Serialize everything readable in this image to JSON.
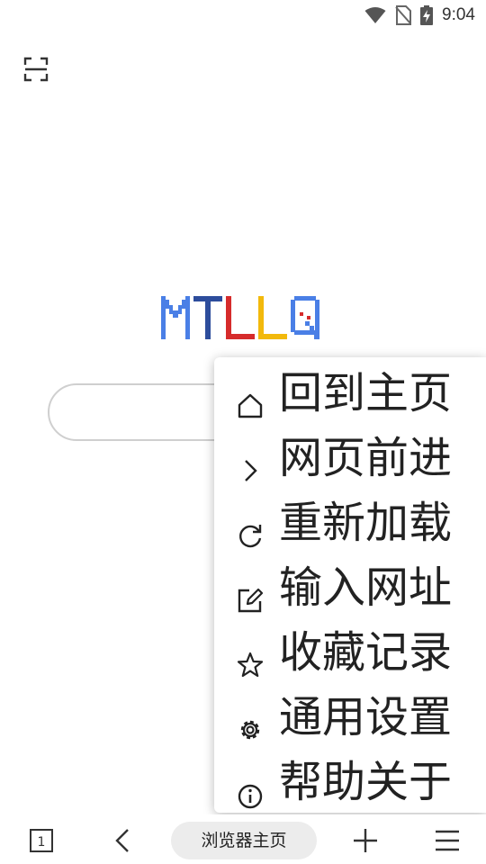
{
  "status_bar": {
    "time": "9:04"
  },
  "logo": {
    "text": "MTLLQ",
    "colors": [
      "#4a7fe6",
      "#2d4d9c",
      "#d62b2b",
      "#f2b90c",
      "#4a7fe6"
    ]
  },
  "search": {
    "placeholder": ""
  },
  "menu": {
    "items": [
      {
        "label": "回到主页",
        "icon": "home-icon"
      },
      {
        "label": "网页前进",
        "icon": "chevron-right-icon"
      },
      {
        "label": "重新加载",
        "icon": "reload-icon"
      },
      {
        "label": "输入网址",
        "icon": "edit-icon"
      },
      {
        "label": "收藏记录",
        "icon": "star-icon"
      },
      {
        "label": "通用设置",
        "icon": "gear-icon"
      },
      {
        "label": "帮助关于",
        "icon": "info-icon"
      }
    ]
  },
  "bottom_bar": {
    "tab_count": "1",
    "home_label": "浏览器主页"
  }
}
